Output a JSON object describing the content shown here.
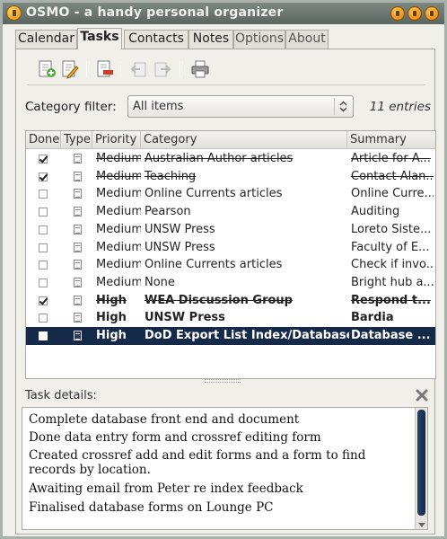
{
  "window": {
    "title": "OSMO - a handy personal organizer"
  },
  "tabs": [
    {
      "label": "Calendar"
    },
    {
      "label": "Tasks"
    },
    {
      "label": "Contacts"
    },
    {
      "label": "Notes"
    },
    {
      "label": "Options"
    },
    {
      "label": "About"
    }
  ],
  "toolbar": {
    "icons": [
      "add-task-icon",
      "edit-task-icon",
      "remove-task-icon",
      "previous-icon",
      "next-icon",
      "print-icon"
    ]
  },
  "filter": {
    "label": "Category filter:",
    "value": "All items",
    "entries": "11 entries"
  },
  "table": {
    "headers": {
      "done": "Done",
      "type": "Type",
      "priority": "Priority",
      "category": "Category",
      "summary": "Summary"
    },
    "rows": [
      {
        "done": true,
        "priority": "Medium",
        "category": "Australian Author articles",
        "summary": "Article for A...",
        "style": "strike"
      },
      {
        "done": true,
        "priority": "Medium",
        "category": "Teaching",
        "summary": "Contact Alan...",
        "style": "strike"
      },
      {
        "done": false,
        "priority": "Medium",
        "category": "Online Currents articles",
        "summary": "Online Curre...",
        "style": "normal"
      },
      {
        "done": false,
        "priority": "Medium",
        "category": "Pearson",
        "summary": "Auditing",
        "style": "normal"
      },
      {
        "done": false,
        "priority": "Medium",
        "category": "UNSW Press",
        "summary": "Loreto Siste...",
        "style": "normal"
      },
      {
        "done": false,
        "priority": "Medium",
        "category": "UNSW Press",
        "summary": "Faculty of E...",
        "style": "normal"
      },
      {
        "done": false,
        "priority": "Medium",
        "category": "Online Currents articles",
        "summary": "Check if invo...",
        "style": "normal"
      },
      {
        "done": false,
        "priority": "Medium",
        "category": "None",
        "summary": "Bright hub a...",
        "style": "normal"
      },
      {
        "done": true,
        "priority": "High",
        "category": "WEA Discussion Group",
        "summary": "Respond t...",
        "style": "bold-strike"
      },
      {
        "done": false,
        "priority": "High",
        "category": "UNSW Press",
        "summary": "Bardia",
        "style": "bold"
      },
      {
        "done": false,
        "priority": "High",
        "category": "DoD Export List Index/Database",
        "summary": "Database ...",
        "style": "bold-selected"
      }
    ]
  },
  "details": {
    "label": "Task details:",
    "lines": [
      "Complete database front end and document",
      "Done data entry form and crossref editing form",
      "Created crossref add and edit forms and a form to find records by location.",
      "Awaiting email from Peter re index feedback",
      "Finalised database forms on Lounge PC"
    ]
  }
}
